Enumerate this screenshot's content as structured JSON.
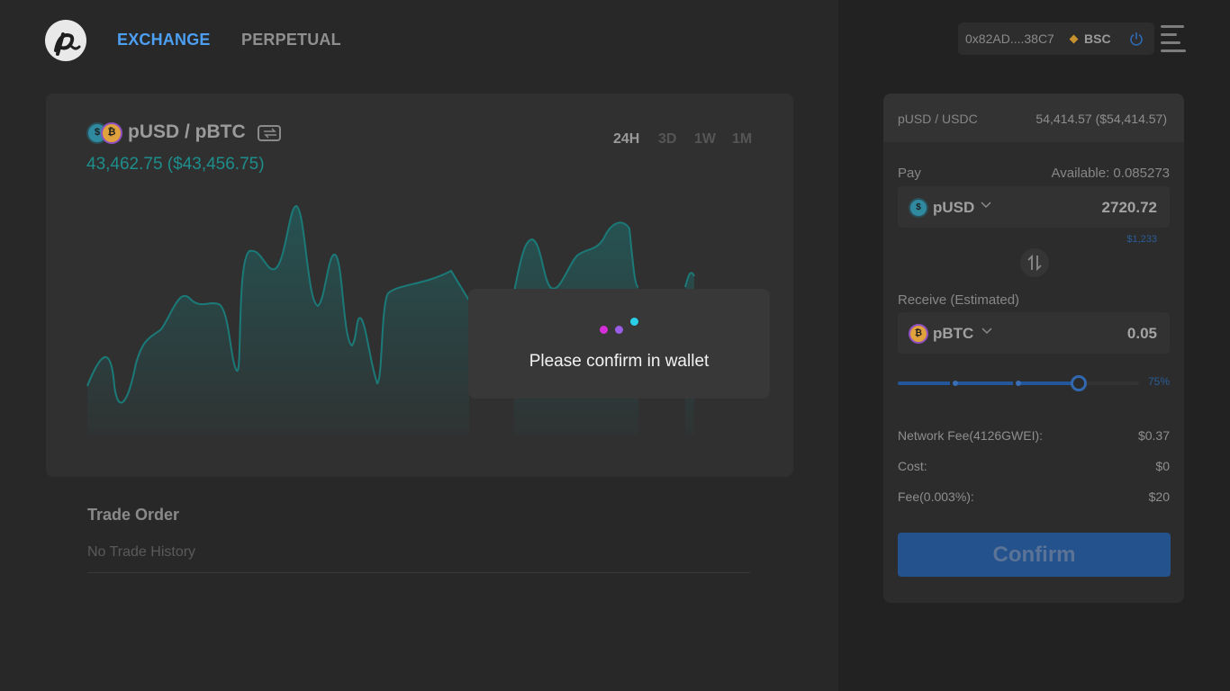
{
  "nav": {
    "exchange": "EXCHANGE",
    "perpetual": "PERPETUAL"
  },
  "chart_panel": {
    "pair": "pUSD / pBTC",
    "price": "43,462.75 ($43,456.75)",
    "timeframes": [
      "24H",
      "3D",
      "1W",
      "1M"
    ],
    "active_timeframe": "24H"
  },
  "trade_order": {
    "title": "Trade Order",
    "empty": "No Trade History"
  },
  "wallet": {
    "address": "0x82AD....38C7",
    "network": "BSC"
  },
  "swap": {
    "pair": "pUSD / USDC",
    "rate": "54,414.57 ($54,414.57)",
    "pay_label": "Pay",
    "available": "Available: 0.085273",
    "pay_token": "pUSD",
    "pay_amount": "2720.72",
    "pay_usd": "$1,233",
    "receive_label": "Receive (Estimated)",
    "receive_token": "pBTC",
    "receive_amount": "0.05",
    "slider_percent": "75%",
    "slider_value": 0.75,
    "fees": [
      {
        "label": "Network Fee(4126GWEI):",
        "value": "$0.37"
      },
      {
        "label": "Cost:",
        "value": "$0"
      },
      {
        "label": "Fee(0.003%):",
        "value": "$20"
      }
    ],
    "confirm": "Confirm"
  },
  "modal": {
    "message": "Please confirm in wallet"
  },
  "colors": {
    "accent": "#4d9ff2",
    "chart_line": "#1e8e8c",
    "confirm_bg": "#23528d",
    "dot_magenta": "#d62fd9",
    "dot_purple": "#9b5de5",
    "dot_cyan": "#2ad0e8"
  }
}
